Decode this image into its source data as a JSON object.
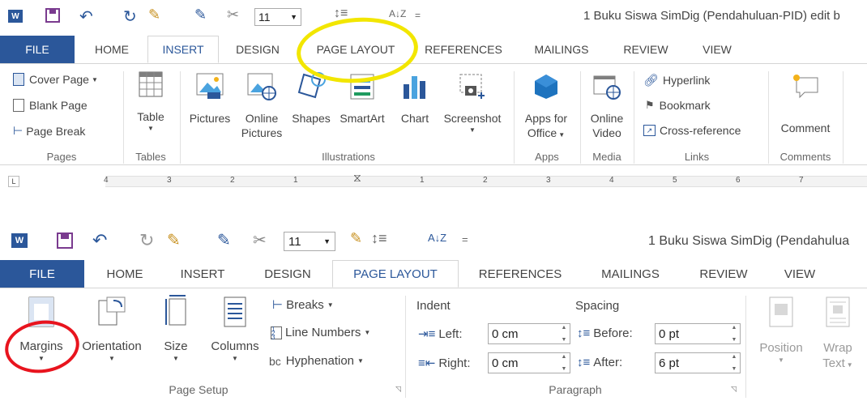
{
  "top": {
    "qat": {
      "font_size": "11"
    },
    "title": "1 Buku Siswa SimDig (Pendahuluan-PID) edit b",
    "tabs": {
      "file": "FILE",
      "home": "HOME",
      "insert": "INSERT",
      "design": "DESIGN",
      "page_layout": "PAGE LAYOUT",
      "references": "REFERENCES",
      "mailings": "MAILINGS",
      "review": "REVIEW",
      "view": "VIEW"
    },
    "ribbon": {
      "pages": {
        "cover_page": "Cover Page",
        "blank_page": "Blank Page",
        "page_break": "Page Break",
        "label": "Pages"
      },
      "tables": {
        "table": "Table",
        "label": "Tables"
      },
      "illustrations": {
        "pictures": "Pictures",
        "online_pictures_1": "Online",
        "online_pictures_2": "Pictures",
        "shapes": "Shapes",
        "smartart": "SmartArt",
        "chart": "Chart",
        "screenshot": "Screenshot",
        "label": "Illustrations"
      },
      "apps": {
        "apps_office_1": "Apps for",
        "apps_office_2": "Office",
        "label": "Apps"
      },
      "media": {
        "online_video_1": "Online",
        "online_video_2": "Video",
        "label": "Media"
      },
      "links": {
        "hyperlink": "Hyperlink",
        "bookmark": "Bookmark",
        "cross_reference": "Cross-reference",
        "label": "Links"
      },
      "comments": {
        "comment": "Comment",
        "label": "Comments"
      }
    },
    "ruler": {
      "numbers": [
        "4",
        "3",
        "2",
        "1",
        "1",
        "2",
        "3",
        "4",
        "5",
        "6",
        "7"
      ]
    }
  },
  "bottom": {
    "qat": {
      "font_size": "11"
    },
    "title": "1 Buku Siswa SimDig (Pendahulua",
    "tabs": {
      "file": "FILE",
      "home": "HOME",
      "insert": "INSERT",
      "design": "DESIGN",
      "page_layout": "PAGE LAYOUT",
      "references": "REFERENCES",
      "mailings": "MAILINGS",
      "review": "REVIEW",
      "view": "VIEW"
    },
    "ribbon": {
      "page_setup": {
        "margins": "Margins",
        "orientation": "Orientation",
        "size": "Size",
        "columns": "Columns",
        "breaks": "Breaks",
        "line_numbers": "Line Numbers",
        "hyphenation": "Hyphenation",
        "label": "Page Setup"
      },
      "paragraph": {
        "indent": "Indent",
        "spacing": "Spacing",
        "left_label": "Left:",
        "left_value": "0 cm",
        "right_label": "Right:",
        "right_value": "0 cm",
        "before_label": "Before:",
        "before_value": "0 pt",
        "after_label": "After:",
        "after_value": "6 pt",
        "label": "Paragraph"
      },
      "arrange": {
        "position": "Position",
        "wrap_1": "Wrap",
        "wrap_2": "Text"
      }
    }
  },
  "colors": {
    "file_tab": "#2b579a",
    "active_tab_text": "#2b579a",
    "yellow_highlight": "#f2e600",
    "red_highlight": "#e8141e"
  }
}
